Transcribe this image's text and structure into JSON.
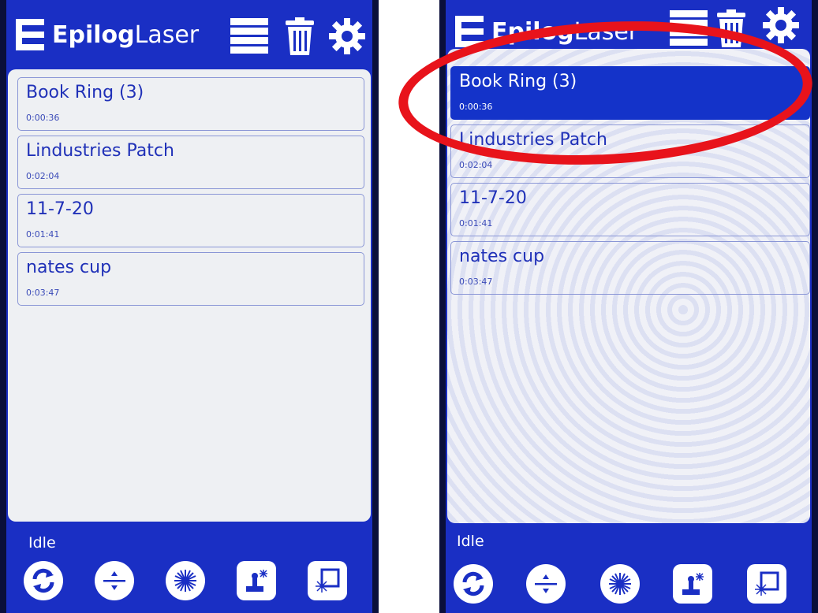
{
  "colors": {
    "accent": "#1a2fc4",
    "panel": "#eef0f3",
    "highlight": "#e8131b"
  },
  "brand": {
    "bold": "Epilog",
    "regular": "Laser"
  },
  "header_icons": [
    "job-list-icon",
    "trash-icon",
    "settings-gear-icon"
  ],
  "left_screen": {
    "jobs": [
      {
        "name": "Book Ring (3)",
        "time": "0:00:36"
      },
      {
        "name": "Lindustries Patch",
        "time": "0:02:04"
      },
      {
        "name": "11-7-20",
        "time": "0:01:41"
      },
      {
        "name": "nates cup",
        "time": "0:03:47"
      }
    ],
    "status": "Idle"
  },
  "right_screen": {
    "jobs": [
      {
        "name": "Book Ring (3)",
        "time": "0:00:36",
        "selected": true
      },
      {
        "name": "Lindustries Patch",
        "time": "0:02:04"
      },
      {
        "name": "11-7-20",
        "time": "0:01:41"
      },
      {
        "name": "nates cup",
        "time": "0:03:47"
      }
    ],
    "status": "Idle"
  },
  "toolbar_icons": [
    "refresh-icon",
    "focus-icon",
    "laser-icon",
    "jog-icon",
    "frame-icon"
  ]
}
